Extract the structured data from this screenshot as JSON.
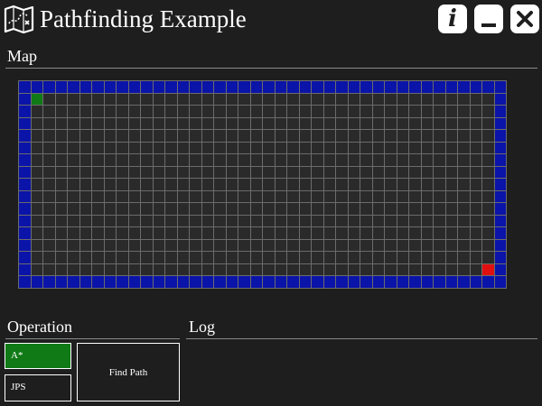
{
  "window": {
    "title": "Pathfinding Example",
    "icon": "map-icon",
    "buttons": {
      "info": "i",
      "minimize_icon": "minimize-icon",
      "close_icon": "close-icon"
    }
  },
  "map": {
    "label": "Map",
    "cols": 40,
    "rows": 17,
    "colors": {
      "wall": "#0a14a8",
      "empty": "#2a2a2a",
      "start": "#0f7a16",
      "goal": "#e01010",
      "grid": "#6b6b6b"
    },
    "start": {
      "col": 1,
      "row": 1
    },
    "goal": {
      "col": 38,
      "row": 15
    }
  },
  "operation": {
    "label": "Operation",
    "algorithms": [
      {
        "label": "A*",
        "selected": true
      },
      {
        "label": "JPS",
        "selected": false
      }
    ],
    "find_path_label": "Find Path",
    "selected_color": "#0f7a16"
  },
  "log": {
    "label": "Log"
  }
}
